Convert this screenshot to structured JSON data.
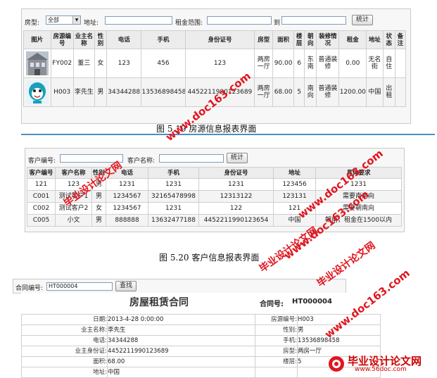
{
  "house_form": {
    "type_label": "房型:",
    "type_select": "全部",
    "addr_label": "地址:",
    "rent_label": "租金范围:",
    "to_label": "到",
    "stats_btn": "统计"
  },
  "house_table": {
    "headers": [
      "图片",
      "房源编号",
      "业主名称",
      "性别",
      "电话",
      "手机",
      "身份证号",
      "房型",
      "面积",
      "楼层",
      "朝向",
      "装修情况",
      "租金",
      "地址",
      "状态",
      "备注"
    ],
    "rows": [
      [
        "",
        "FY002",
        "董三",
        "女",
        "123",
        "456",
        "123",
        "两房一厅",
        "90.00",
        "6",
        "东南",
        "普通装修",
        "0.00",
        "无名街",
        "自住",
        ""
      ],
      [
        "",
        "H003",
        "李先生",
        "男",
        "34344288",
        "13536898458",
        "4452211990123689",
        "两房一厅",
        "68.00",
        "5",
        "南向",
        "普通装修",
        "1200.00",
        "中国",
        "出租",
        ""
      ]
    ]
  },
  "caption1": "图 5.19  房源信息报表界面",
  "customer_form": {
    "id_label": "客户编号:",
    "name_label": "客户名称:",
    "stats_btn": "统计"
  },
  "customer_table": {
    "headers": [
      "客户编号",
      "客户名称",
      "性别",
      "电话",
      "手机",
      "身份证号",
      "地址",
      "具体要求"
    ],
    "rows": [
      [
        "121",
        "123",
        "男",
        "1231",
        "1231",
        "1231",
        "123456",
        "1231"
      ],
      [
        "C001",
        "测试客户1",
        "男",
        "1234567",
        "32165478998",
        "12313122",
        "123131",
        "需要南南向"
      ],
      [
        "C002",
        "测试客户2",
        "女",
        "1234567",
        "1231",
        "122",
        "121",
        "需要朝南向"
      ],
      [
        "C005",
        "小文",
        "男",
        "888888",
        "13632477188",
        "4452211990123654",
        "中国",
        "朝南，租金在1500以内"
      ]
    ]
  },
  "caption2": "图 5.20  客户信息报表界面",
  "contract_form": {
    "label": "合同编号:",
    "value": "HT000004",
    "search_btn": "查找"
  },
  "contract": {
    "title": "房屋租赁合同",
    "no_label": "合同号:",
    "no_value": "HT000004",
    "fields": [
      [
        "日期:",
        "2013-4-28 0:00:00",
        "房源编号:",
        "H003"
      ],
      [
        "业主名称:",
        "李先生",
        "性别:",
        "男"
      ],
      [
        "电话:",
        "34344288",
        "手机:",
        "13536898458"
      ],
      [
        "业主身份证:",
        "4452211990123689",
        "房型:",
        "两房一厅"
      ],
      [
        "面积:",
        "68.00",
        "楼层:",
        "5"
      ],
      [
        "地址:",
        "中国",
        "",
        ""
      ]
    ]
  },
  "watermarks": {
    "site1": "www.doc163.com",
    "brand1": "毕业设计论文网",
    "site2": "www.doc163.com",
    "brand2": "毕业设计论文网",
    "site3": "www.doc163.com",
    "brand3": "毕业设计论文网",
    "site4": "www.doc163.com",
    "brand4": "毕业设计论文网",
    "corner_brand": "毕业设计论文网",
    "corner_site": "www.56doc.com"
  },
  "colors": {
    "accent_line": "#4a8fc4",
    "watermark": "#e0161f"
  }
}
